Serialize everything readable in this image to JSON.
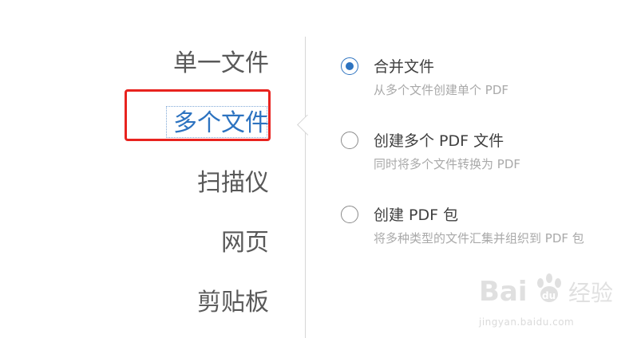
{
  "categories": [
    {
      "label": "单一文件",
      "selected": false
    },
    {
      "label": "多个文件",
      "selected": true
    },
    {
      "label": "扫描仪",
      "selected": false
    },
    {
      "label": "网页",
      "selected": false
    },
    {
      "label": "剪贴板",
      "selected": false
    }
  ],
  "options": [
    {
      "title": "合并文件",
      "description": "从多个文件创建单个 PDF",
      "checked": true
    },
    {
      "title": "创建多个 PDF 文件",
      "description": "同时将多个文件转换为 PDF",
      "checked": false
    },
    {
      "title": "创建 PDF 包",
      "description": "将多种类型的文件汇集并组织到 PDF 包",
      "checked": false
    }
  ],
  "watermark": {
    "brand": "Baidu 经验",
    "url": "jingyan.baidu.com"
  },
  "colors": {
    "accent": "#2d73c0",
    "highlight": "#e8231f",
    "text": "#595959",
    "muted": "#a9a9a9"
  }
}
